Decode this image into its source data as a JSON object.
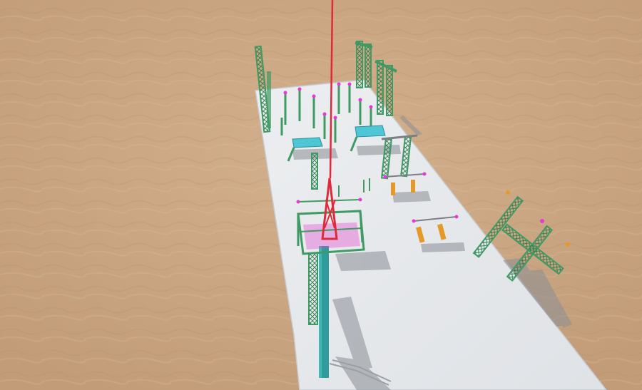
{
  "scene": {
    "description_label": "",
    "colors": {
      "ground": "#c9a683",
      "ground_light": "#d7b896",
      "ground_dark": "#b88f6c",
      "slab": "#e4e7ea",
      "slab_edge": "#c7ccd1",
      "steel_green": "#3f9a63",
      "steel_teal": "#2f9c9a",
      "accent_magenta": "#e43bd0",
      "accent_red": "#e02a3a",
      "accent_orange": "#e39a2b",
      "shadow": "#8b8f96",
      "cyan_panel": "#4dc6d6"
    }
  }
}
